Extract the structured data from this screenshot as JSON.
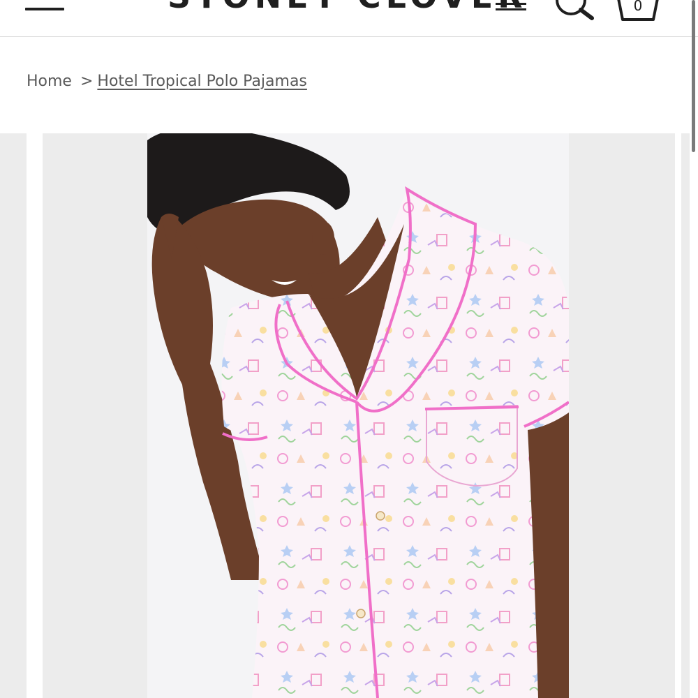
{
  "header": {
    "brand": "STONEY CLOVER",
    "cart_count": "0"
  },
  "breadcrumb": {
    "home": "Home",
    "separator": ">",
    "current": "Hotel Tropical Polo Pajamas"
  },
  "gallery": {
    "product_image": "model wearing Hotel Tropical Polo Pajamas top",
    "accent_pink": "#f06fc8",
    "fabric_color": "#fbf3f8"
  },
  "icons": {
    "menu": "hamburger-menu-icon",
    "search": "search-icon",
    "cart": "cart-icon"
  }
}
